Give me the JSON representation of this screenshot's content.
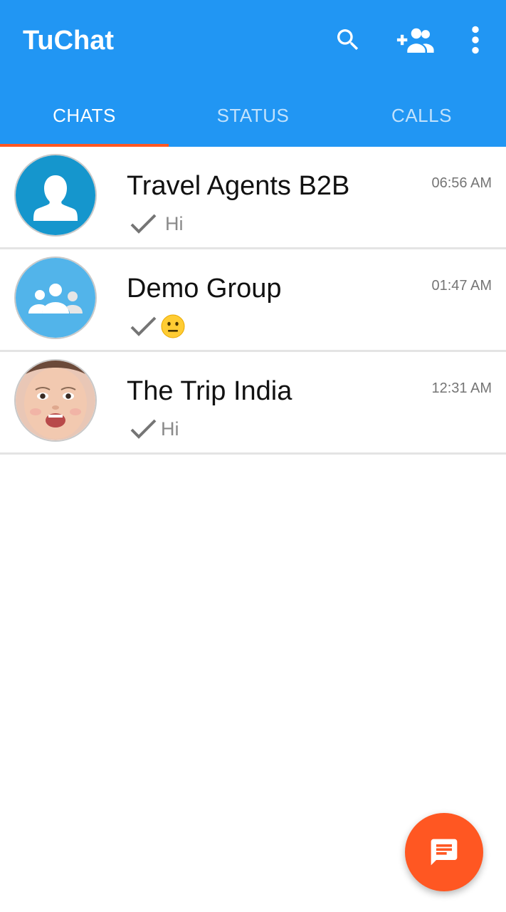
{
  "app": {
    "title": "TuChat",
    "colors": {
      "primary": "#2196F3",
      "accent": "#FF5722",
      "divider": "#e4e4e4"
    }
  },
  "header": {
    "actions": [
      {
        "icon": "search-icon"
      },
      {
        "icon": "add-user-icon"
      },
      {
        "icon": "more-vert-icon"
      }
    ]
  },
  "tabs": [
    {
      "label": "CHATS",
      "active": true
    },
    {
      "label": "STATUS",
      "active": false
    },
    {
      "label": "CALLS",
      "active": false
    }
  ],
  "chats": [
    {
      "name": "Travel Agents B2B",
      "time": "06:56 AM",
      "preview": "Hi",
      "avatar": "person-silhouette-icon",
      "status": "sent"
    },
    {
      "name": "Demo Group",
      "time": "01:47 AM",
      "preview_emoji": "neutral-face-emoji",
      "avatar": "group-icon",
      "status": "sent"
    },
    {
      "name": "The Trip India",
      "time": "12:31 AM",
      "preview": "Hi",
      "avatar": "child-photo",
      "status": "sent"
    }
  ],
  "fab": {
    "icon": "message-icon"
  }
}
